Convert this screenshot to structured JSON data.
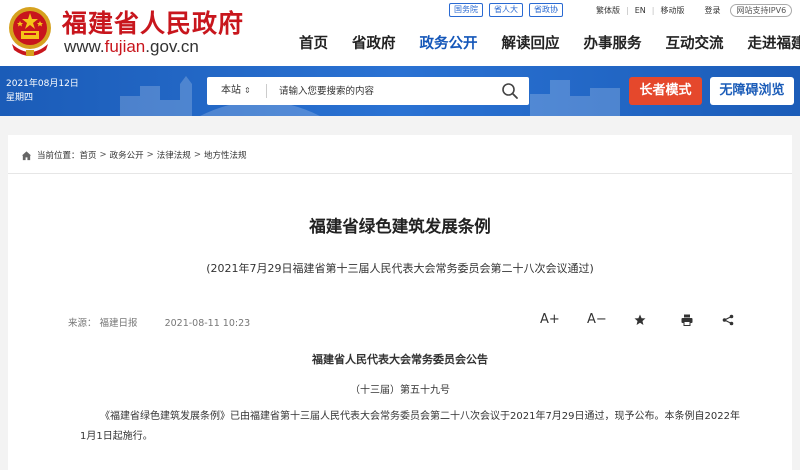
{
  "header": {
    "site_name": "福建省人民政府",
    "domain_prefix": "www.",
    "domain_accent": "fujian",
    "domain_suffix": ".gov.cn",
    "top_links": [
      "国务院",
      "省人大",
      "省政协"
    ],
    "util": {
      "traditional": "繁体版",
      "english": "EN",
      "mobile": "移动版",
      "login": "登录",
      "ipv6": "网站支持IPV6"
    },
    "nav": [
      "首页",
      "省政府",
      "政务公开",
      "解读回应",
      "办事服务",
      "互动交流",
      "走进福建"
    ],
    "nav_active": "政务公开"
  },
  "banner": {
    "date": "2021年08月12日",
    "weekday": "星期四",
    "search_scope": "本站",
    "search_scope_arrow": "⇕",
    "search_placeholder": "请输入您要搜索的内容",
    "elder_mode": "长者模式",
    "accessible": "无障碍浏览"
  },
  "breadcrumb": {
    "prefix": "当前位置：",
    "items": [
      "首页",
      "政务公开",
      "法律法规",
      "地方性法规"
    ],
    "separator": ">"
  },
  "article": {
    "title": "福建省绿色建筑发展条例",
    "subtitle": "(2021年7月29日福建省第十三届人民代表大会常务委员会第二十八次会议通过)",
    "source": "来源：  福建日报",
    "date": "2021-08-11 10:23",
    "font_up": "A+",
    "font_down": "A−",
    "notice_title": "福建省人民代表大会常务委员会公告",
    "notice_number": "（十三届）第五十九号",
    "body": "《福建省绿色建筑发展条例》已由福建省第十三届人民代表大会常务委员会第二十八次会议于2021年7月29日通过，现予公布。本条例自2022年1月1日起施行。"
  },
  "colors": {
    "brand_red": "#c8161d",
    "nav_active_blue": "#1557b9",
    "banner_blue": "#1b5cb8",
    "elder_orange": "#e5482c"
  }
}
